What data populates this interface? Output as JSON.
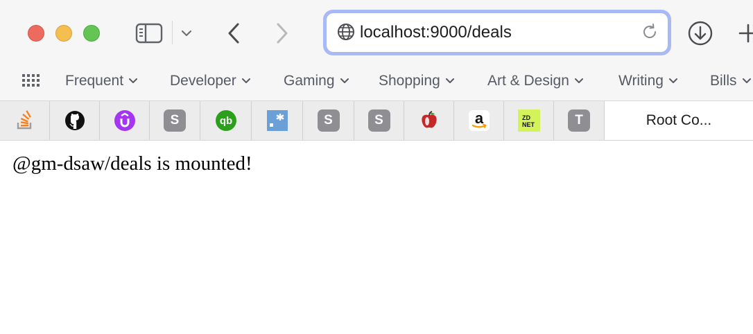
{
  "browser": {
    "address_bar": {
      "url": "localhost:9000/deals"
    }
  },
  "favorites": {
    "items": [
      {
        "label": "Frequent"
      },
      {
        "label": "Developer"
      },
      {
        "label": "Gaming"
      },
      {
        "label": "Shopping"
      },
      {
        "label": "Art & Design"
      },
      {
        "label": "Writing"
      },
      {
        "label": "Bills"
      }
    ]
  },
  "pinned_tabs": {
    "icons": [
      "stackoverflow-icon",
      "github-icon",
      "udemy-icon",
      "s-icon",
      "quickbooks-icon",
      "confluence-icon",
      "s-icon",
      "s-icon",
      "apple-icon",
      "amazon-icon",
      "zdnet-icon",
      "t-icon"
    ],
    "letters": {
      "s": "S",
      "t": "T",
      "zdnet_top": "ZD",
      "zdnet_bottom": "NET"
    },
    "root_tab_label": "Root Co..."
  },
  "page": {
    "message": "@gm-dsaw/deals is mounted!"
  },
  "colors": {
    "close": "#ed6a5e",
    "minimize": "#f5bf4f",
    "maximize": "#62c554",
    "url_focus_ring": "#a9b9f6"
  }
}
